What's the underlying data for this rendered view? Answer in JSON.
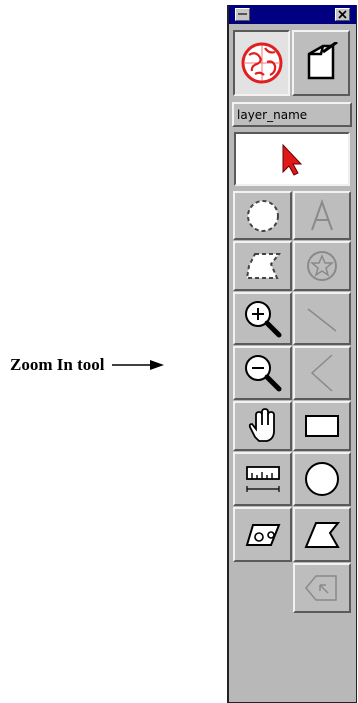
{
  "callout": {
    "label": "Zoom In tool",
    "points_to": "zoom-in-tool"
  },
  "palette": {
    "layer_name": "layer_name",
    "current_tool": "arrow-select",
    "top_buttons": [
      {
        "name": "map-globe-icon",
        "state": "pressed"
      },
      {
        "name": "document-page-icon",
        "state": "raised"
      }
    ],
    "tools": [
      {
        "name": "circle-select-tool",
        "enabled": true
      },
      {
        "name": "text-tool",
        "enabled": false
      },
      {
        "name": "lasso-select-tool",
        "enabled": true
      },
      {
        "name": "symbol-tool",
        "enabled": false
      },
      {
        "name": "zoom-in-tool",
        "enabled": true
      },
      {
        "name": "line-tool",
        "enabled": false
      },
      {
        "name": "zoom-out-tool",
        "enabled": true
      },
      {
        "name": "polyline-tool",
        "enabled": false
      },
      {
        "name": "pan-tool",
        "enabled": true
      },
      {
        "name": "rectangle-tool",
        "enabled": true
      },
      {
        "name": "measure-tool",
        "enabled": true
      },
      {
        "name": "circle-tool",
        "enabled": true
      },
      {
        "name": "identify-tool",
        "enabled": true
      },
      {
        "name": "polygon-tool",
        "enabled": true
      },
      {
        "name": "delete-vertex-tool",
        "enabled": false
      }
    ],
    "colors": {
      "titlebar": "#000080",
      "panel": "#b8b8b8",
      "globe": "#e02020",
      "pointer": "#e01818"
    }
  }
}
